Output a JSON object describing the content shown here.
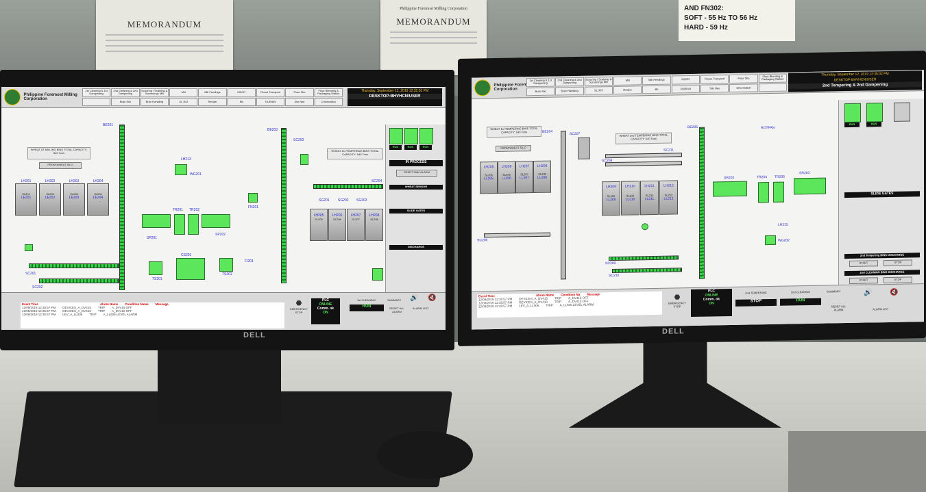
{
  "background": {
    "memo_left": "MEMORANDUM",
    "memo_right_corp": "Philippine Foremost Milling Corporation",
    "memo_right": "MEMORANDUM",
    "notice_lines": [
      "AND FN302:",
      "SOFT  - 55 Hz TO 56 Hz",
      "HARD  - 59 Hz"
    ],
    "monitor_brand": "DELL"
  },
  "left_screen": {
    "corp_name": "Philippine Foremost Milling Corporation",
    "nav": [
      "1st Cleaning & 1st Dampening",
      "2nd Cleaning & 2nd Dampening",
      "Scouring / Scalping & Screenings Mill",
      "Mill",
      "Mill Feedings",
      "MSCR",
      "Flours Transport",
      "Flour Silo",
      "Flour Blending & Packaging Station",
      "",
      "Bran Silo",
      "Bran Handling",
      "SL 303",
      "Recipe",
      "Bb",
      "DURIAN",
      "Silo Nav",
      "Chlorination"
    ],
    "date": "Thursday, September 12, 2019 12:35:02 PM",
    "station": "DESKTOP-BHVHCN\\USER",
    "labels": {
      "wheat_bins": "WHEAT AT MILLING BINS TOTAL CAPACITY: 840 Tons",
      "from_silo": "FROM WHEAT SILO",
      "tempering": "WHEAT 1st TEMPERING BINS TOTAL CAPACITY: 540 Tons",
      "in_process": "IN PROCESS",
      "reset_alarm": "RESET 2682 ALARM",
      "wheat_sensor": "WHEAT SENSOR",
      "slide_gates": "SLIDE GATES",
      "discharge": "DISCHARGE"
    },
    "bins": [
      {
        "lh": "LH201",
        "sl": "SL201",
        "le": "LE201"
      },
      {
        "lh": "LH202",
        "sl": "SL202",
        "le": "LE202"
      },
      {
        "lh": "LH203",
        "sl": "SL203",
        "le": "LE203"
      },
      {
        "lh": "LH204",
        "sl": "SL204",
        "le": "LE204"
      }
    ],
    "bins2": [
      {
        "lh": "LH205",
        "sl": "SL205"
      },
      {
        "lh": "LH206",
        "sl": "SL206"
      },
      {
        "lh": "LH207",
        "sl": "SL207"
      },
      {
        "lh": "LH208",
        "sl": "SL208"
      }
    ],
    "tags": {
      "be201": "BE201",
      "be203": "BE203",
      "lh213": "LH213",
      "wg201": "WG201",
      "sc203": "SC203",
      "sc204": "SC204",
      "sg201": "SG201",
      "sg202": "SG202",
      "sg203": "SG203",
      "tr201": "TR201",
      "tr202": "TR202",
      "sp201": "SP201",
      "sp202": "SP202",
      "fn201": "FN201",
      "cs201": "CS201",
      "ts201": "TS201",
      "ts202": "TS202",
      "fi201": "FI201",
      "sc201": "SC201",
      "sc202": "SC202"
    },
    "panel_buttons": [
      "RUN",
      "RUN",
      "RUN"
    ],
    "alarm_header": [
      "Event Time",
      "Alarm Name",
      "Condition Name",
      "Message"
    ],
    "alarms": [
      {
        "time": "12/09/2019 12:35:57 PM",
        "name": "DEVICES_A_DV415",
        "cond": "TRIP",
        "msg": "A_DV415 OFF"
      },
      {
        "time": "12/09/2019 12:35:57 PM",
        "name": "DEVICES_A_DV410",
        "cond": "TRIP",
        "msg": "A_DV410 OFF"
      },
      {
        "time": "12/09/2019 12:35:57 PM",
        "name": "LEV_A_LL506",
        "cond": "TRIP",
        "msg": "A_LL506 LEVEL ALARM"
      }
    ],
    "emergency": "EMERGENCY STOP",
    "plc": "PLC",
    "online": "ONLINE",
    "comm": "Comm. ok",
    "on": "ON",
    "cleaning": "1st CLEANING",
    "run": "RUN",
    "summary": "SUMMARY",
    "reset_alarm_btn": "RESET ALL ALARM",
    "alarm_list": "ALARM LIST"
  },
  "right_screen": {
    "corp_name": "Philippine Foremost Milling Corporation",
    "nav": [
      "1st Cleaning & 1st Dampening",
      "2nd Cleaning & 2nd Dampening",
      "Scouring / Scalping & Screenings Mill",
      "Mill",
      "Mill Feedings",
      "MSCR",
      "Flours Transport",
      "Flour Silo",
      "Flour Blending & Packaging Station",
      "Bran Silo",
      "Bran Handling",
      "SL 303",
      "Recipe",
      "Bb",
      "DURIAN",
      "Silo Nav",
      "Chlorination",
      ""
    ],
    "date": "Thursday, September 12, 2019 12:35:02 PM",
    "station": "DESKTOP-BHVHCN\\USER",
    "title": "2nd Tempering & 2nd Dampening",
    "labels": {
      "wheat_bins": "WHEAT 1st TEMPERING BINS TOTAL CAPACITY: 540 Tons",
      "from_silo": "FROM WHEAT SILO",
      "tempering2": "WHEAT 2nd TEMPERING BINS TOTAL CAPACITY: 540 Tons",
      "slide_gates": "SLIDE GATES",
      "discharge_tempering": "2nd Tempering BINS DISCHARGE",
      "discharge_cleaning": "2nd CLEANING BINS DISCHARGE",
      "start": "START",
      "stop": "STOP"
    },
    "bins": [
      {
        "lh": "LH205",
        "sl": "SL205",
        "ll": "LL205"
      },
      {
        "lh": "LH206",
        "sl": "SL206",
        "ll": "LL206"
      },
      {
        "lh": "LH207",
        "sl": "SL207",
        "ll": "LL207"
      },
      {
        "lh": "LH208",
        "sl": "SL208",
        "ll": "LL208"
      }
    ],
    "bins2": [
      {
        "lh": "LH209",
        "sl": "SL209",
        "ll": "LL209"
      },
      {
        "lh": "LH210",
        "sl": "SL210",
        "ll": "LL210"
      },
      {
        "lh": "LH211",
        "sl": "SL211",
        "ll": "LL211"
      },
      {
        "lh": "LH212",
        "sl": "SL212",
        "ll": "LL212"
      }
    ],
    "tags": {
      "be204": "BE204",
      "sc207": "SC207",
      "sc208": "SC208",
      "sc211": "SC211",
      "be205": "BE205",
      "sr202": "SR202",
      "tr204": "TR204",
      "tr205": "TR205",
      "sr203": "SR203",
      "lh215": "LH215",
      "wg202": "WG202",
      "sc206": "SC206",
      "sc209": "SC209",
      "sc210": "SC210",
      "sc205": "SC205",
      "rotfan": "ROTFAN"
    },
    "alarm_header": [
      "Event Time",
      "Alarm Name",
      "Condition Na",
      "Message"
    ],
    "alarms": [
      {
        "time": "12/09/2019 12:35:57 PM",
        "name": "DEVICES_A_DV415",
        "cond": "TRIP",
        "msg": "A_DV415 OFF"
      },
      {
        "time": "12/09/2019 12:35:57 PM",
        "name": "DEVICES_A_DV410",
        "cond": "TRIP",
        "msg": "A_DV410 OFF"
      },
      {
        "time": "12/09/2019 12:35:57 PM",
        "name": "LEV_A_LL506",
        "cond": "TRIP",
        "msg": "A_LL506 LEVEL ALARM"
      }
    ],
    "emergency": "EMERGENCY STOP",
    "plc": "PLC",
    "online": "ONLINE",
    "comm": "Comm. ok",
    "on": "ON",
    "tempering": "2nd TEMPERING",
    "cleaning": "2nd CLEANING",
    "stop": "STOP",
    "run": "RUN",
    "summary": "SUMMARY",
    "reset_alarm_btn": "RESET ALL ALARM",
    "alarm_list": "ALARM LIST",
    "panel_run": [
      "RUN",
      "RUN"
    ]
  }
}
